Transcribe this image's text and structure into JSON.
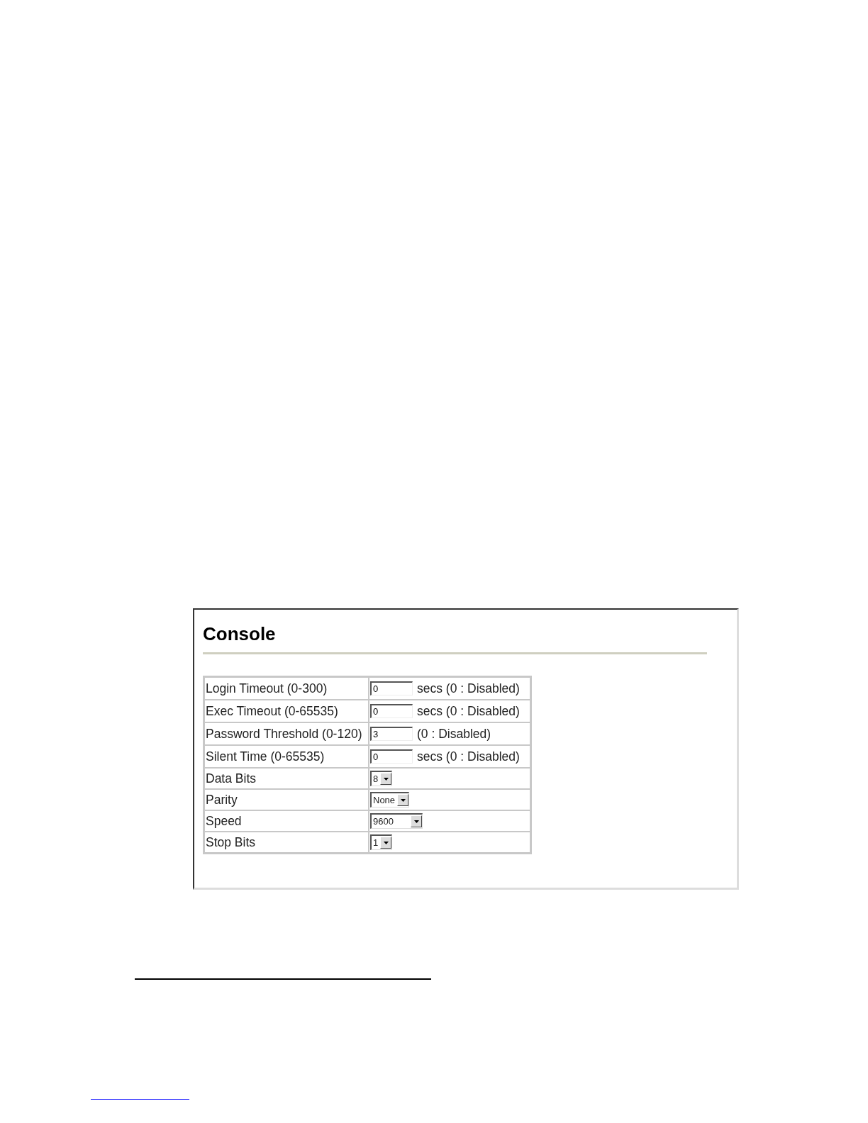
{
  "panel": {
    "title": "Console",
    "rows": [
      {
        "label": "Login Timeout (0-300)",
        "kind": "text",
        "value": "0",
        "note": "secs (0 : Disabled)"
      },
      {
        "label": "Exec Timeout (0-65535)",
        "kind": "text",
        "value": "0",
        "note": "secs (0 : Disabled)"
      },
      {
        "label": "Password Threshold (0-120)",
        "kind": "text",
        "value": "3",
        "note": "(0 : Disabled)"
      },
      {
        "label": "Silent Time (0-65535)",
        "kind": "text",
        "value": "0",
        "note": "secs (0 : Disabled)"
      },
      {
        "label": "Data Bits",
        "kind": "select",
        "value": "8"
      },
      {
        "label": "Parity",
        "kind": "select",
        "value": "None"
      },
      {
        "label": "Speed",
        "kind": "select",
        "value": "9600"
      },
      {
        "label": "Stop Bits",
        "kind": "select",
        "value": "1"
      }
    ]
  }
}
